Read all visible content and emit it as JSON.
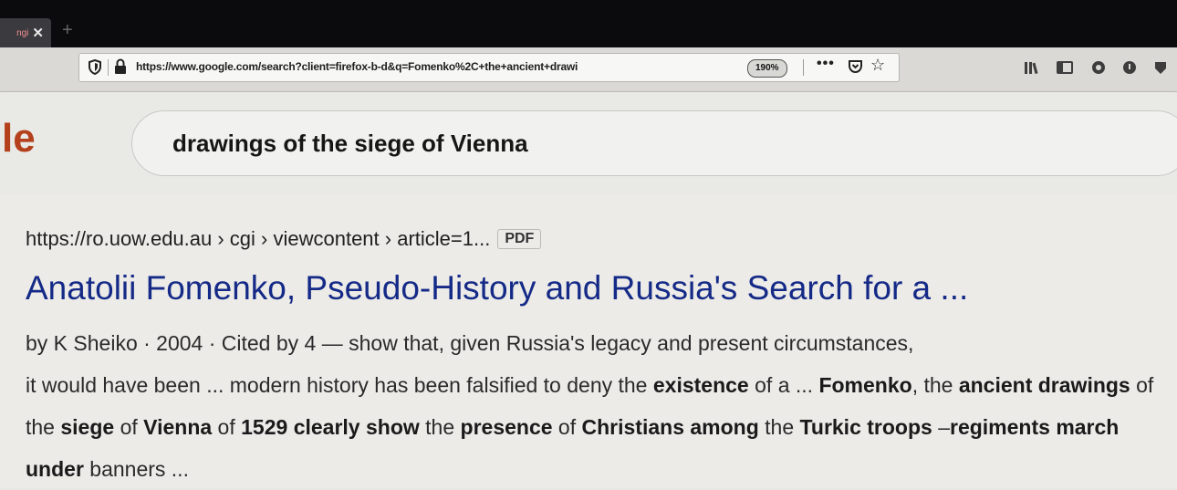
{
  "browser": {
    "tab": {
      "title": "ngi",
      "close_label": "✕"
    },
    "newtab_label": "+",
    "url": "https://www.google.com/search?client=firefox-b-d&q=Fomenko%2C+the+ancient+drawi",
    "zoom_label": "190%",
    "more_label": "•••",
    "toolbar_icons": [
      "library-icon",
      "sidebar-icon",
      "extension-icon",
      "extension-icon-2",
      "extension-icon-3"
    ]
  },
  "google": {
    "logo_fragment": "le",
    "query": "drawings of the siege of Vienna"
  },
  "result": {
    "cite": "https://ro.uow.edu.au › cgi › viewcontent › article=1...",
    "badge": "PDF",
    "title": "Anatolii Fomenko, Pseudo-History and Russia's Search for a ...",
    "snippet_line1": "by K Sheiko · 2004 · Cited by 4 — show that, given Russia's legacy and present circumstances,",
    "snippet_segments": [
      {
        "text": "it would have been ... modern history has been falsified to deny the ",
        "bold": false
      },
      {
        "text": "existence",
        "bold": true
      },
      {
        "text": " of a ... ",
        "bold": false
      },
      {
        "text": "Fomenko",
        "bold": true
      },
      {
        "text": ", the ",
        "bold": false
      },
      {
        "text": "ancient drawings",
        "bold": true
      },
      {
        "text": " of the ",
        "bold": false
      },
      {
        "text": "siege",
        "bold": true
      },
      {
        "text": " of ",
        "bold": false
      },
      {
        "text": "Vienna",
        "bold": true
      },
      {
        "text": " of ",
        "bold": false
      },
      {
        "text": "1529 clearly show",
        "bold": true
      },
      {
        "text": " the ",
        "bold": false
      },
      {
        "text": "presence",
        "bold": true
      },
      {
        "text": " of ",
        "bold": false
      },
      {
        "text": "Christians among",
        "bold": true
      },
      {
        "text": " the ",
        "bold": false
      },
      {
        "text": "Turkic troops",
        "bold": true
      },
      {
        "text": " –",
        "bold": false
      },
      {
        "text": "regiments march under",
        "bold": true
      },
      {
        "text": " banners ...",
        "bold": false
      }
    ]
  }
}
